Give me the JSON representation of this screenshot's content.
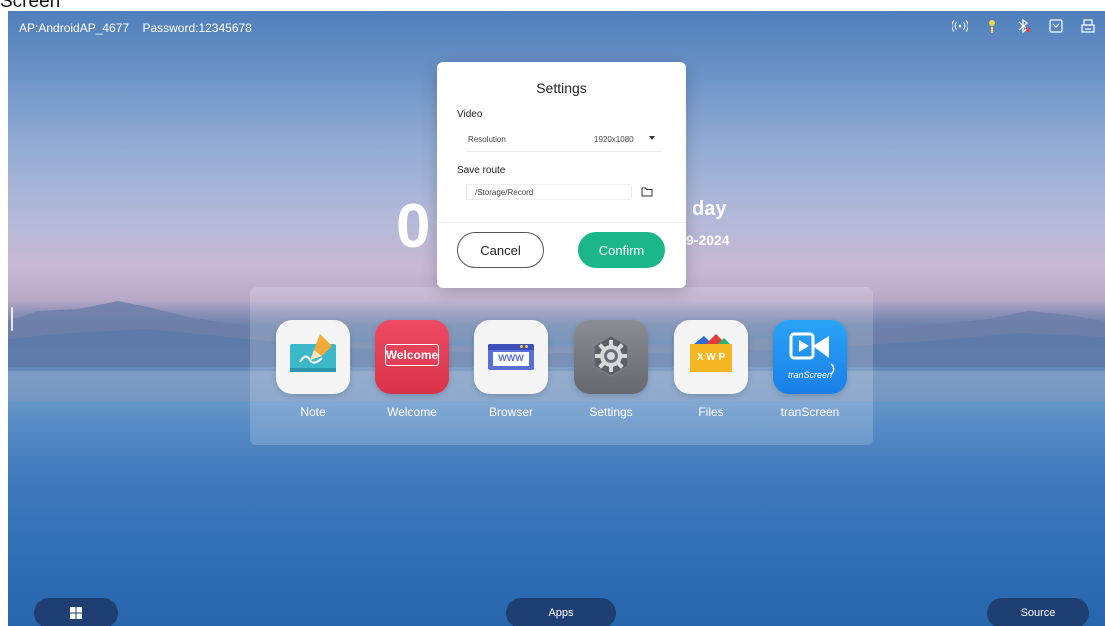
{
  "page": {
    "heading": "Screen"
  },
  "status_bar": {
    "ap_text": "AP:AndroidAP_4677",
    "password_text": "Password:12345678",
    "icons": [
      "hotspot-icon",
      "brightness-icon",
      "bluetooth-off-icon",
      "screen-icon",
      "printer-icon"
    ]
  },
  "home": {
    "clock_partial": "0",
    "day_partial": "day",
    "date_partial": "9-2024"
  },
  "dock": {
    "apps": [
      {
        "label": "Note",
        "icon": "note-icon"
      },
      {
        "label": "Welcome",
        "icon": "welcome-icon",
        "icon_text": "Welcome"
      },
      {
        "label": "Browser",
        "icon": "browser-icon",
        "icon_text": "WWW"
      },
      {
        "label": "Settings",
        "icon": "settings-gear-icon"
      },
      {
        "label": "Files",
        "icon": "files-icon",
        "icon_text": "X W P"
      },
      {
        "label": "tranScreen",
        "icon": "transcreen-icon",
        "icon_text": "tranScreen"
      }
    ]
  },
  "bottom_bar": {
    "windows_icon": "windows-icon",
    "apps_label": "Apps",
    "source_label": "Source"
  },
  "dialog": {
    "title": "Settings",
    "video_section": "Video",
    "resolution_label": "Resolution",
    "resolution_value": "1920x1080",
    "save_route_section": "Save route",
    "save_route_value": "/Storage/Record",
    "cancel_label": "Cancel",
    "confirm_label": "Confirm"
  },
  "colors": {
    "confirm": "#1bb68a",
    "bottom_button": "#1f3f72",
    "welcome_icon": "#e8435a",
    "transcreen_icon": "#1d8ff0"
  }
}
